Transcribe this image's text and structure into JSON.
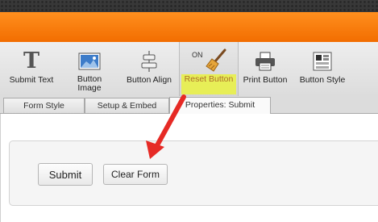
{
  "toolbar": {
    "items": [
      {
        "label": "Submit Text",
        "icon": "text-T-icon"
      },
      {
        "label": "Button Image",
        "icon": "image-icon"
      },
      {
        "label": "Button Align",
        "icon": "align-icon"
      },
      {
        "label": "Reset Button",
        "icon": "broom-icon",
        "toggle": "ON"
      },
      {
        "label": "Print Button",
        "icon": "printer-icon"
      },
      {
        "label": "Button Style",
        "icon": "style-icon"
      }
    ]
  },
  "tabs": [
    "Form Style",
    "Setup & Embed",
    "Properties: Submit"
  ],
  "form": {
    "submit_label": "Submit",
    "clear_label": "Clear Form"
  },
  "colors": {
    "header_orange": "#f57c0a",
    "highlight_yellow": "#e7ee57",
    "arrow_red": "#e62a25"
  }
}
